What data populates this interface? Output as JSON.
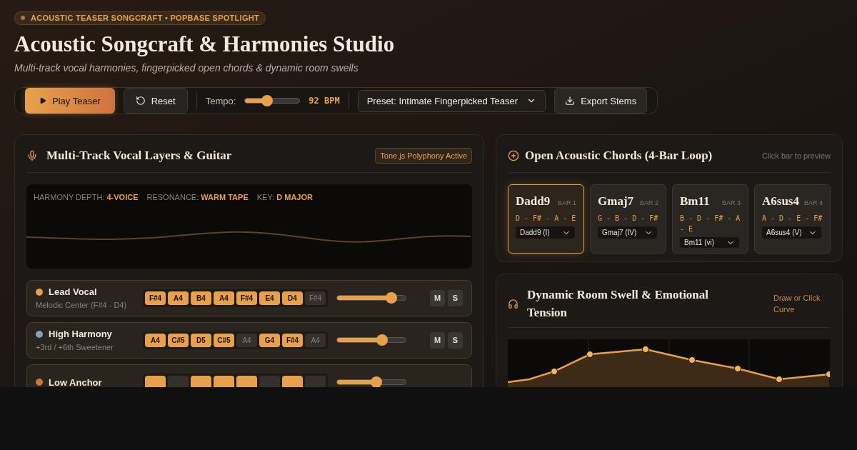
{
  "badge": "ACOUSTIC TEASER SONGCRAFT • POPBASE SPOTLIGHT",
  "title": "Acoustic Songcraft & Harmonies Studio",
  "subtitle": "Multi-track vocal harmonies, fingerpicked open chords & dynamic room swells",
  "toolbar": {
    "play": "Play Teaser",
    "reset": "Reset",
    "tempo_label": "Tempo:",
    "tempo": {
      "level": 0.41,
      "reading": "92 BPM"
    },
    "preset": "Preset: Intimate Fingerpicked Teaser",
    "export": "Export Stems"
  },
  "tracks_panel": {
    "title": "Multi-Track Vocal Layers & Guitar",
    "status": "Tone.js Polyphony Active",
    "info": [
      {
        "label": "HARMONY DEPTH:",
        "value": "4-VOICE"
      },
      {
        "label": "RESONANCE:",
        "value": "WARM TAPE"
      },
      {
        "label": "KEY:",
        "value": "D MAJOR"
      }
    ],
    "tracks": [
      {
        "name": "Lead Vocal",
        "detail": "Melodic Center (F#4 - D4)",
        "color": "#e8a14a",
        "level": 0.79,
        "mute": "M",
        "solo": "S",
        "notes": [
          {
            "label": "F#4",
            "on": true
          },
          {
            "label": "A4",
            "on": true
          },
          {
            "label": "B4",
            "on": true
          },
          {
            "label": "A4",
            "on": true
          },
          {
            "label": "F#4",
            "on": true
          },
          {
            "label": "E4",
            "on": true
          },
          {
            "label": "D4",
            "on": true
          },
          {
            "label": "F#4",
            "on": false
          }
        ]
      },
      {
        "name": "High Harmony",
        "detail": "+3rd / +6th Sweetener",
        "color": "#7fa3bf",
        "level": 0.66,
        "mute": "M",
        "solo": "S",
        "notes": [
          {
            "label": "A4",
            "on": true
          },
          {
            "label": "C#5",
            "on": true
          },
          {
            "label": "D5",
            "on": true
          },
          {
            "label": "C#5",
            "on": true
          },
          {
            "label": "A4",
            "on": false
          },
          {
            "label": "G4",
            "on": true
          },
          {
            "label": "F#4",
            "on": true
          },
          {
            "label": "A4",
            "on": false
          }
        ]
      },
      {
        "name": "Low Anchor",
        "color": "#d0733d",
        "level": 0.57,
        "notes": [
          {
            "on": true
          },
          {
            "on": false
          },
          {
            "on": true
          },
          {
            "on": true
          },
          {
            "on": true
          },
          {
            "on": false
          },
          {
            "on": true
          },
          {
            "on": false
          }
        ]
      }
    ]
  },
  "chords_panel": {
    "title": "Open Acoustic Chords (4-Bar Loop)",
    "hint": "Click bar to preview",
    "chords": [
      {
        "name": "Dadd9",
        "bar": "BAR 1",
        "notes": "D - F# - A - E",
        "choice": "Dadd9 (I)",
        "selected": true
      },
      {
        "name": "Gmaj7",
        "bar": "BAR 2",
        "notes": "G - B - D - F#",
        "choice": "Gmaj7 (IV)",
        "selected": false
      },
      {
        "name": "Bm11",
        "bar": "BAR 3",
        "notes": "B - D - F# - A - E",
        "choice": "Bm11 (vi)",
        "selected": false
      },
      {
        "name": "A6sus4",
        "bar": "BAR 4",
        "notes": "A - D - E - F#",
        "choice": "A6sus4 (V)",
        "selected": false
      }
    ]
  },
  "swell_panel": {
    "title": "Dynamic Room Swell & Emotional Tension",
    "hint": "Draw or Click Curve"
  }
}
